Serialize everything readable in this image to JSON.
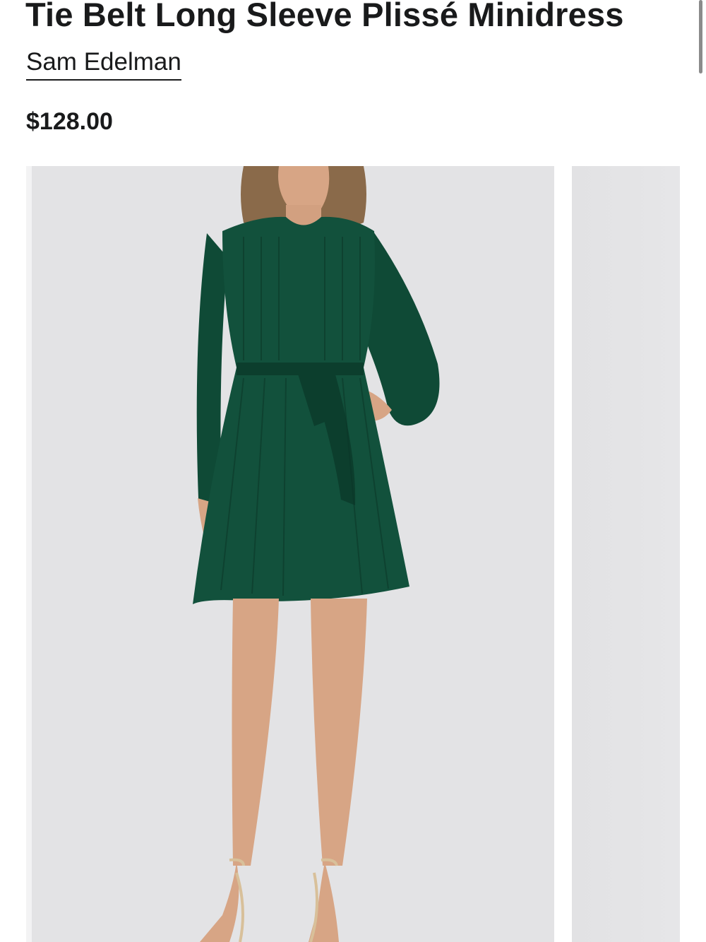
{
  "product": {
    "title": "Tie Belt Long Sleeve Plissé Minidress",
    "brand": "Sam Edelman",
    "price": "$128.00"
  },
  "gallery": {
    "images": [
      {
        "subject": "model-wearing-dress",
        "dress_color": "#12513c"
      },
      {
        "subject": "next-image-preview"
      }
    ]
  },
  "colors": {
    "text": "#191a1b",
    "photo_background": "#e3e3e5",
    "dress": "#12513c",
    "dress_shadow": "#0c3e2d",
    "skin": "#d7a585",
    "hair": "#8a6a4a",
    "sandal": "#d8c09a"
  }
}
